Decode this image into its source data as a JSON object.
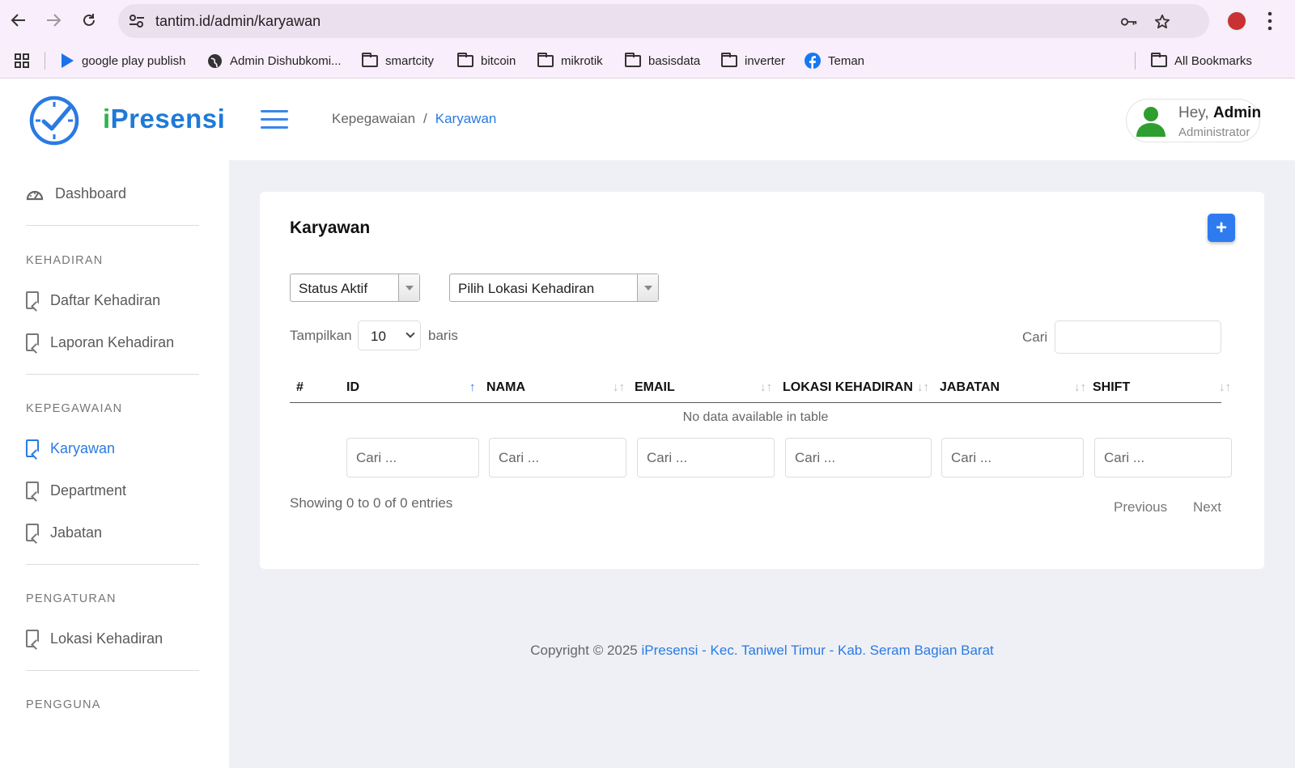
{
  "browser": {
    "url": "tantim.id/admin/karyawan",
    "bookmarks": [
      {
        "label": "google play publish",
        "icon": "play-icon"
      },
      {
        "label": "Admin Dishubkomi...",
        "icon": "globe-icon"
      },
      {
        "label": "smartcity",
        "icon": "folder-icon"
      },
      {
        "label": "bitcoin",
        "icon": "folder-icon"
      },
      {
        "label": "mikrotik",
        "icon": "folder-icon"
      },
      {
        "label": "basisdata",
        "icon": "folder-icon"
      },
      {
        "label": "inverter",
        "icon": "folder-icon"
      },
      {
        "label": "Teman",
        "icon": "facebook-icon"
      }
    ],
    "all_bookmarks": "All Bookmarks"
  },
  "header": {
    "logo": {
      "first": "i",
      "rest": "Presensi"
    },
    "breadcrumb": {
      "parent": "Kepegawaian",
      "separator": "/",
      "current": "Karyawan"
    },
    "user": {
      "greeting": "Hey,",
      "name": "Admin",
      "role": "Administrator"
    }
  },
  "sidebar": {
    "dashboard": "Dashboard",
    "sections": {
      "kehadiran": "KEHADIRAN",
      "kepegawaian": "KEPEGAWAIAN",
      "pengaturan": "PENGATURAN",
      "pengguna": "PENGGUNA"
    },
    "items": {
      "daftar_kehadiran": "Daftar Kehadiran",
      "laporan_kehadiran": "Laporan Kehadiran",
      "karyawan": "Karyawan",
      "department": "Department",
      "jabatan": "Jabatan",
      "lokasi_kehadiran": "Lokasi Kehadiran"
    }
  },
  "main": {
    "title": "Karyawan",
    "add_button": "+",
    "filters": {
      "status": "Status Aktif",
      "lokasi": "Pilih Lokasi Kehadiran"
    },
    "length": {
      "prefix": "Tampilkan",
      "value": "10",
      "suffix": "baris"
    },
    "search": {
      "label": "Cari"
    },
    "columns": [
      "#",
      "ID",
      "NAMA",
      "EMAIL",
      "LOKASI KEHADIRAN",
      "JABATAN",
      "SHIFT"
    ],
    "empty_message": "No data available in table",
    "column_filter_placeholder": "Cari ...",
    "info": "Showing 0 to 0 of 0 entries",
    "pagination": {
      "previous": "Previous",
      "next": "Next"
    }
  },
  "footer": {
    "prefix": "Copyright © 2025 ",
    "link": "iPresensi - Kec. Taniwel Timur - Kab. Seram Bagian Barat"
  },
  "colors": {
    "accent": "#2a7ae2",
    "logo_green": "#2db34a",
    "main_bg": "#eef0f6"
  }
}
